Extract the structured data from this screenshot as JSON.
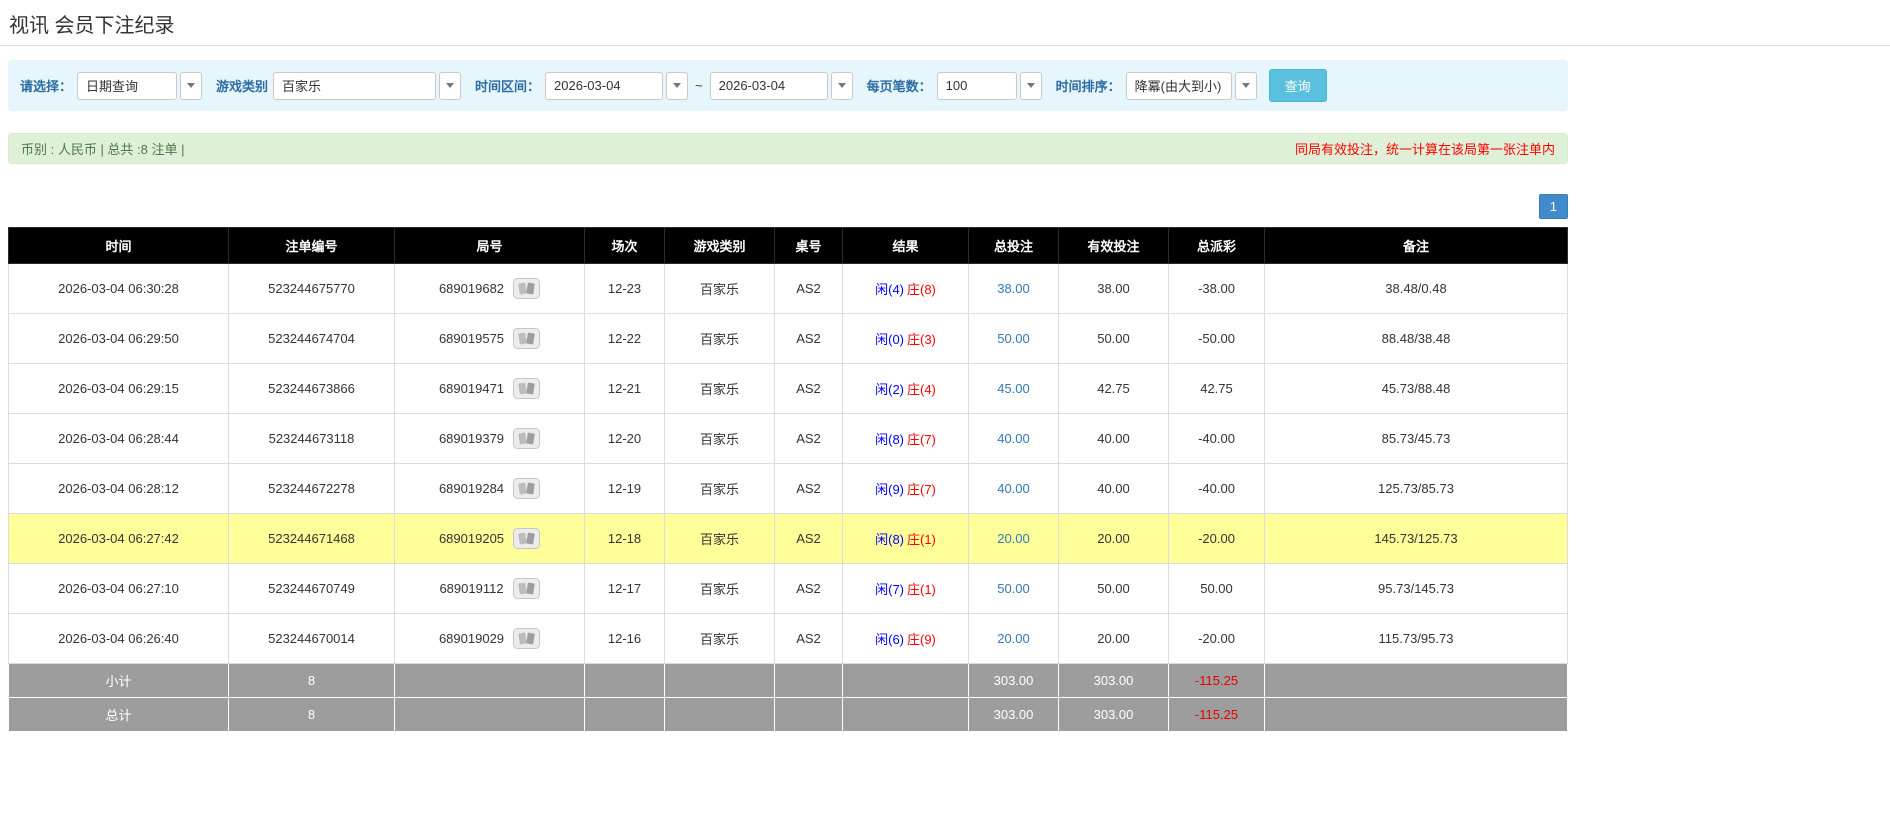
{
  "page": {
    "title": "视讯 会员下注纪录"
  },
  "filters": {
    "select_label": "请选择：",
    "select_value": "日期查询",
    "game_type_label": "游戏类别",
    "game_type_value": "百家乐",
    "time_range_label": "时间区间：",
    "date_from": "2026-03-04",
    "date_separator": "~",
    "date_to": "2026-03-04",
    "page_size_label": "每页笔数：",
    "page_size_value": "100",
    "sort_label": "时间排序：",
    "sort_value": "降冪(由大到小)",
    "search_button": "查询"
  },
  "summary": {
    "left_text": "币别 : 人民币 | 总共 :8 注单 |",
    "right_text": "同局有效投注，统一计算在该局第一张注单内"
  },
  "pagination": {
    "current": "1"
  },
  "table": {
    "headers": [
      "时间",
      "注单编号",
      "局号",
      "场次",
      "游戏类别",
      "桌号",
      "结果",
      "总投注",
      "有效投注",
      "总派彩",
      "备注"
    ],
    "rows": [
      {
        "time": "2026-03-04 06:30:28",
        "bet_id": "523244675770",
        "round_id": "689019682",
        "session": "12-23",
        "game": "百家乐",
        "table_no": "AS2",
        "result_player": "闲(4)",
        "result_banker": "庄(8)",
        "total_bet": "38.00",
        "valid_bet": "38.00",
        "payout": "-38.00",
        "remark": "38.48/0.48",
        "highlight": false
      },
      {
        "time": "2026-03-04 06:29:50",
        "bet_id": "523244674704",
        "round_id": "689019575",
        "session": "12-22",
        "game": "百家乐",
        "table_no": "AS2",
        "result_player": "闲(0)",
        "result_banker": "庄(3)",
        "total_bet": "50.00",
        "valid_bet": "50.00",
        "payout": "-50.00",
        "remark": "88.48/38.48",
        "highlight": false
      },
      {
        "time": "2026-03-04 06:29:15",
        "bet_id": "523244673866",
        "round_id": "689019471",
        "session": "12-21",
        "game": "百家乐",
        "table_no": "AS2",
        "result_player": "闲(2)",
        "result_banker": "庄(4)",
        "total_bet": "45.00",
        "valid_bet": "42.75",
        "payout": "42.75",
        "remark": "45.73/88.48",
        "highlight": false
      },
      {
        "time": "2026-03-04 06:28:44",
        "bet_id": "523244673118",
        "round_id": "689019379",
        "session": "12-20",
        "game": "百家乐",
        "table_no": "AS2",
        "result_player": "闲(8)",
        "result_banker": "庄(7)",
        "total_bet": "40.00",
        "valid_bet": "40.00",
        "payout": "-40.00",
        "remark": "85.73/45.73",
        "highlight": false
      },
      {
        "time": "2026-03-04 06:28:12",
        "bet_id": "523244672278",
        "round_id": "689019284",
        "session": "12-19",
        "game": "百家乐",
        "table_no": "AS2",
        "result_player": "闲(9)",
        "result_banker": "庄(7)",
        "total_bet": "40.00",
        "valid_bet": "40.00",
        "payout": "-40.00",
        "remark": "125.73/85.73",
        "highlight": false
      },
      {
        "time": "2026-03-04 06:27:42",
        "bet_id": "523244671468",
        "round_id": "689019205",
        "session": "12-18",
        "game": "百家乐",
        "table_no": "AS2",
        "result_player": "闲(8)",
        "result_banker": "庄(1)",
        "total_bet": "20.00",
        "valid_bet": "20.00",
        "payout": "-20.00",
        "remark": "145.73/125.73",
        "highlight": true
      },
      {
        "time": "2026-03-04 06:27:10",
        "bet_id": "523244670749",
        "round_id": "689019112",
        "session": "12-17",
        "game": "百家乐",
        "table_no": "AS2",
        "result_player": "闲(7)",
        "result_banker": "庄(1)",
        "total_bet": "50.00",
        "valid_bet": "50.00",
        "payout": "50.00",
        "remark": "95.73/145.73",
        "highlight": false
      },
      {
        "time": "2026-03-04 06:26:40",
        "bet_id": "523244670014",
        "round_id": "689019029",
        "session": "12-16",
        "game": "百家乐",
        "table_no": "AS2",
        "result_player": "闲(6)",
        "result_banker": "庄(9)",
        "total_bet": "20.00",
        "valid_bet": "20.00",
        "payout": "-20.00",
        "remark": "115.73/95.73",
        "highlight": false
      }
    ],
    "subtotal": {
      "label": "小计",
      "count": "8",
      "total_bet": "303.00",
      "valid_bet": "303.00",
      "payout": "-115.25"
    },
    "total": {
      "label": "总计",
      "count": "8",
      "total_bet": "303.00",
      "valid_bet": "303.00",
      "payout": "-115.25"
    }
  },
  "colors": {
    "accent_button": "#5bc0de",
    "pagination_blue": "#428bca",
    "link_blue": "#337ab7",
    "player_blue": "#0000ff",
    "banker_red": "#ff0000",
    "negative_red": "#ff0000",
    "highlight_yellow": "#ffff99",
    "header_black": "#000000",
    "footer_gray": "#9d9d9d",
    "summary_green_bg": "#dff0d8",
    "filter_blue_bg": "#e7f5fc"
  }
}
